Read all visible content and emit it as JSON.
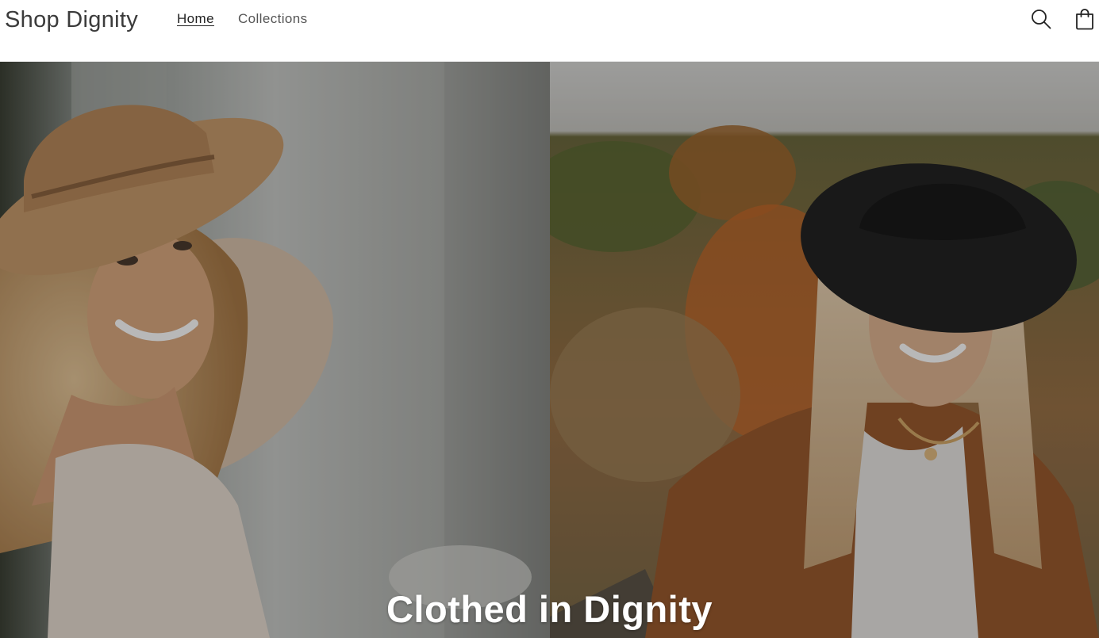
{
  "header": {
    "logo": "Shop Dignity",
    "nav": [
      {
        "label": "Home",
        "active": true
      },
      {
        "label": "Collections",
        "active": false
      }
    ],
    "icons": [
      "search-icon",
      "cart-icon"
    ]
  },
  "hero": {
    "title": "Clothed in Dignity",
    "images": [
      "woman-in-tan-hat-photo",
      "woman-in-black-hat-photo"
    ]
  },
  "colors": {
    "text": "#3b3b3b",
    "overlay": "#000000",
    "background": "#ffffff"
  }
}
